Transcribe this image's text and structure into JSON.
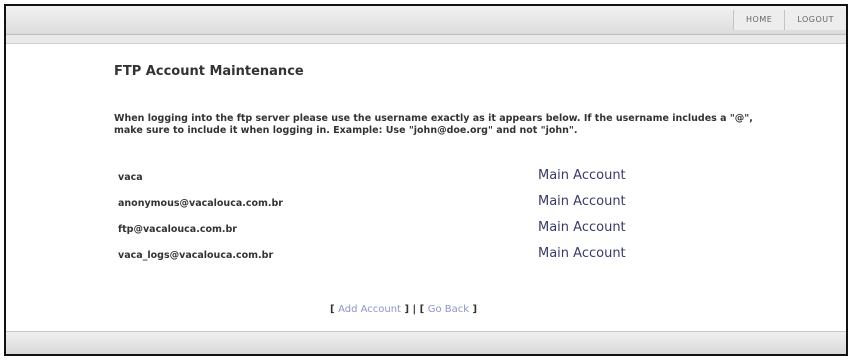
{
  "nav": {
    "home": "HOME",
    "logout": "LOGOUT"
  },
  "page": {
    "title": "FTP Account Maintenance",
    "info": "When logging into the ftp server please use the username exactly as it appears below. If the username includes a \"@\", make sure to include it when logging in. Example: Use \"john@doe.org\" and not \"john\"."
  },
  "accounts": [
    {
      "username": "vaca",
      "type": "Main Account"
    },
    {
      "username": "anonymous@vacalouca.com.br",
      "type": "Main Account"
    },
    {
      "username": "ftp@vacalouca.com.br",
      "type": "Main Account"
    },
    {
      "username": "vaca_logs@vacalouca.com.br",
      "type": "Main Account"
    }
  ],
  "actions": {
    "open": "[",
    "add": "Add Account",
    "sep": "] | [",
    "back": "Go Back",
    "close": "]"
  }
}
